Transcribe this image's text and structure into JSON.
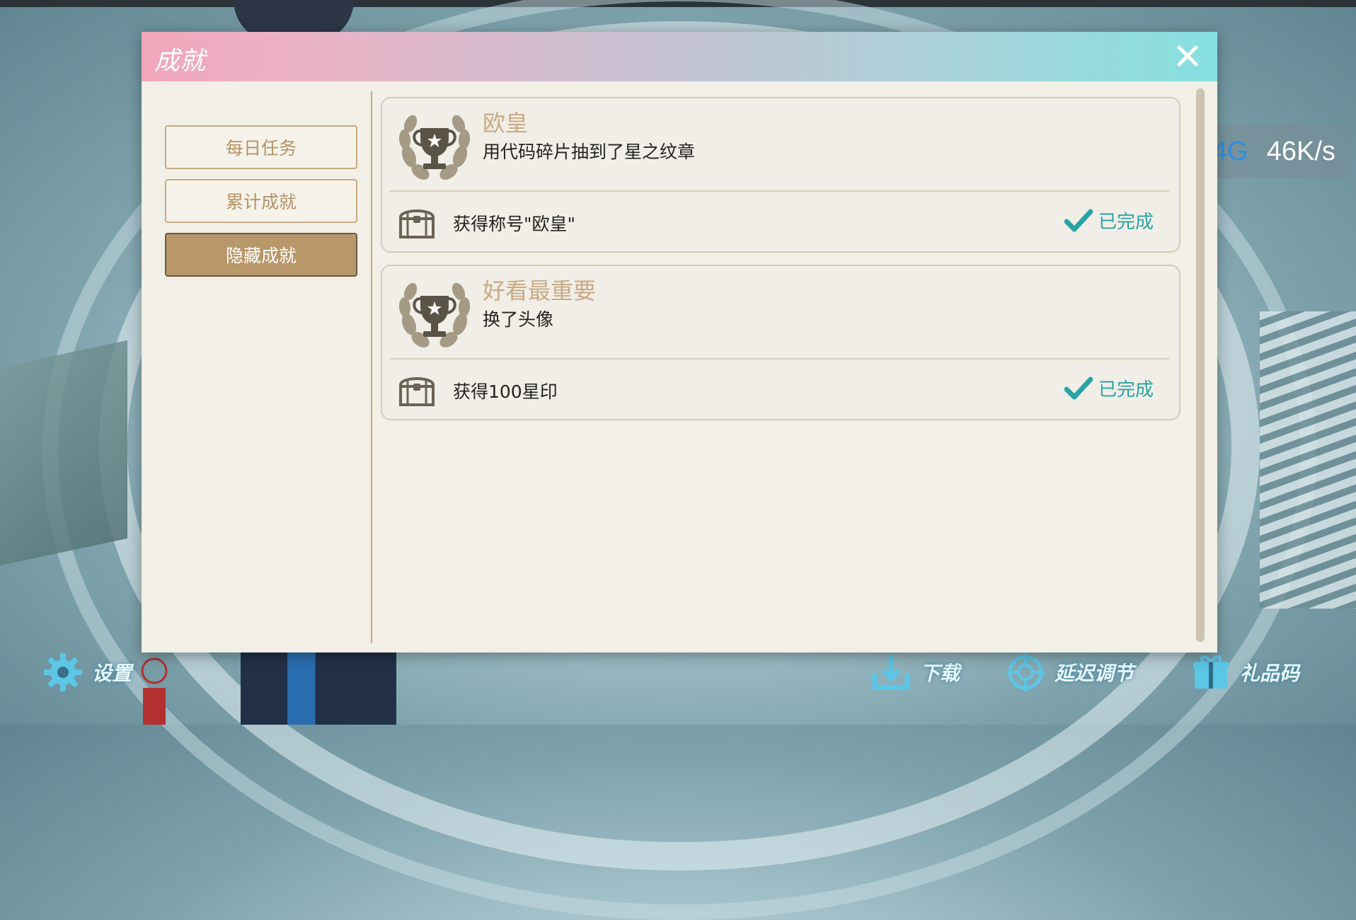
{
  "network": {
    "type": "4G",
    "speed": "46K/s"
  },
  "dialog": {
    "title": "成就",
    "tabs": [
      {
        "label": "每日任务",
        "active": false
      },
      {
        "label": "累计成就",
        "active": false
      },
      {
        "label": "隐藏成就",
        "active": true
      }
    ],
    "achievements": [
      {
        "title": "欧皇",
        "description": "用代码碎片抽到了星之纹章",
        "reward": "获得称号\"欧皇\"",
        "status": "已完成"
      },
      {
        "title": "好看最重要",
        "description": "换了头像",
        "reward": "获得100星印",
        "status": "已完成"
      }
    ]
  },
  "bottom_bar": {
    "settings": "设置",
    "download": "下载",
    "latency": "延迟调节",
    "gift_code": "礼品码"
  },
  "colors": {
    "accent_gold": "#c8ab85",
    "complete_teal": "#2aa3a6",
    "net_type_blue": "#2f8fe0"
  }
}
